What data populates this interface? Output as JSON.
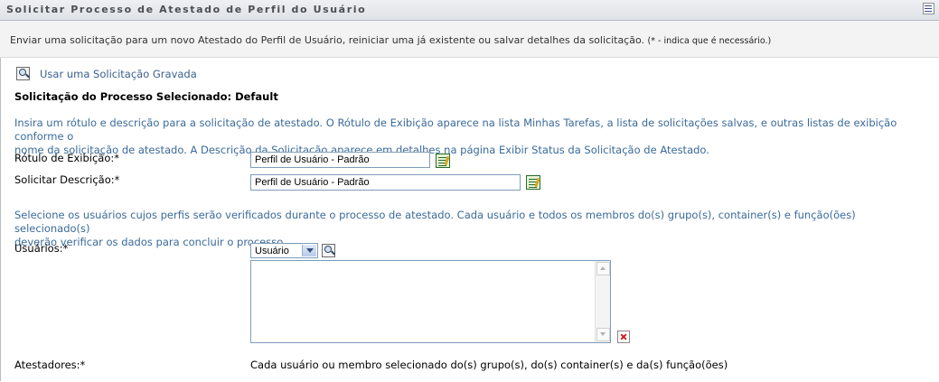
{
  "header": {
    "title": "Solicitar Processo de Atestado de Perfil do Usuário"
  },
  "info": {
    "text": "Enviar uma solicitação para um novo Atestado do Perfil de Usuário, reiniciar uma já existente ou salvar detalhes da solicitação.",
    "required_note": "(* - indica que é necessário.)"
  },
  "saved_request": {
    "link": "Usar uma Solicitação Gravada"
  },
  "selected_process": {
    "heading": "Solicitação do Processo Selecionado: Default"
  },
  "intro": {
    "line1": "Insira um rótulo e descrição para a solicitação de atestado. O Rótulo de Exibição aparece na lista Minhas Tarefas, a lista de solicitações salvas, e outras listas de exibição conforme o",
    "line2": "nome da solicitação de atestado. A Descrição da Solicitação aparece em detalhes na página Exibir Status da Solicitação de Atestado."
  },
  "form": {
    "display_label": {
      "label": "Rótulo de Exibição:*",
      "value": "Perfil de Usuário - Padrão"
    },
    "description": {
      "label": "Solicitar Descrição:*",
      "value": "Perfil de Usuário - Padrão"
    }
  },
  "users_intro": {
    "line1": "Selecione os usuários cujos perfis serão verificados durante o processo de atestado. Cada usuário e todos os membros do(s) grupo(s), container(s) e função(ões) selecionado(s)",
    "line2": "deverão verificar os dados para concluir o processo."
  },
  "users": {
    "label": "Usuários:*",
    "type_selected": "Usuário",
    "items": []
  },
  "attesters": {
    "label": "Atestadores:*",
    "value": "Cada usuário ou membro selecionado do(s) grupo(s), do(s) container(s) e da(s) função(ões)"
  }
}
